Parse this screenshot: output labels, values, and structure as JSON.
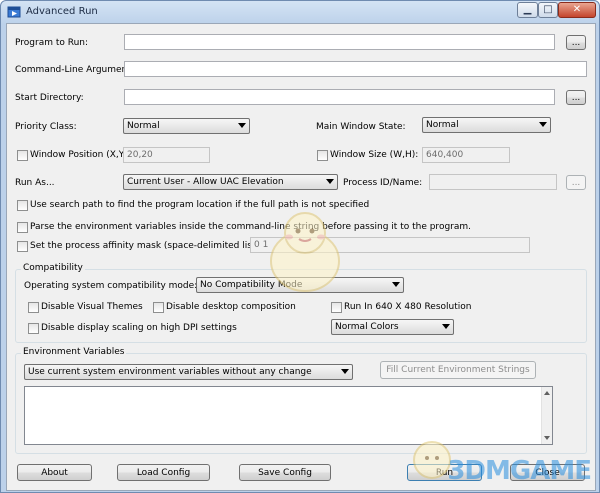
{
  "window": {
    "title": "Advanced Run",
    "icon": "app-icon"
  },
  "title_buttons": {
    "minimize": "▁",
    "maximize": "□",
    "close": "✕"
  },
  "program_to_run": {
    "label": "Program to Run:",
    "value": "",
    "browse": "..."
  },
  "command_line": {
    "label": "Command-Line Arguments:",
    "value": ""
  },
  "start_directory": {
    "label": "Start Directory:",
    "value": "",
    "browse": "..."
  },
  "priority_class": {
    "label": "Priority Class:",
    "selected": "Normal"
  },
  "main_window_state": {
    "label": "Main Window State:",
    "selected": "Normal"
  },
  "window_position": {
    "label": "Window Position (X,Y):",
    "value": "20,20",
    "checked": false
  },
  "window_size": {
    "label": "Window Size (W,H):",
    "value": "640,400",
    "checked": false
  },
  "run_as": {
    "label": "Run As...",
    "selected": "Current User - Allow UAC Elevation"
  },
  "process_id": {
    "label": "Process ID/Name:",
    "value": "",
    "browse": "..."
  },
  "options": {
    "search_path": "Use search path to find the program location if the full path is not specified",
    "parse_env": "Parse the environment variables inside the command-line string before passing it to the program.",
    "affinity": "Set the process affinity mask (space-delimited list):",
    "affinity_value": "0 1"
  },
  "compatibility": {
    "title": "Compatibility",
    "mode_label": "Operating system compatibility mode:",
    "mode_selected": "No Compatibility Mode",
    "disable_visual_themes": "Disable Visual Themes",
    "disable_desktop_composition": "Disable desktop composition",
    "run_640": "Run In 640 X 480 Resolution",
    "disable_dpi_scaling": "Disable display scaling on high DPI settings",
    "colors_selected": "Normal Colors"
  },
  "environment": {
    "title": "Environment Variables",
    "selected": "Use current system environment variables without any change",
    "fill_button": "Fill Current Environment Strings"
  },
  "footer": {
    "about": "About",
    "load_config": "Load Config",
    "save_config": "Save Config",
    "run": "Run",
    "close": "Close"
  },
  "watermark": "3DMGAME"
}
